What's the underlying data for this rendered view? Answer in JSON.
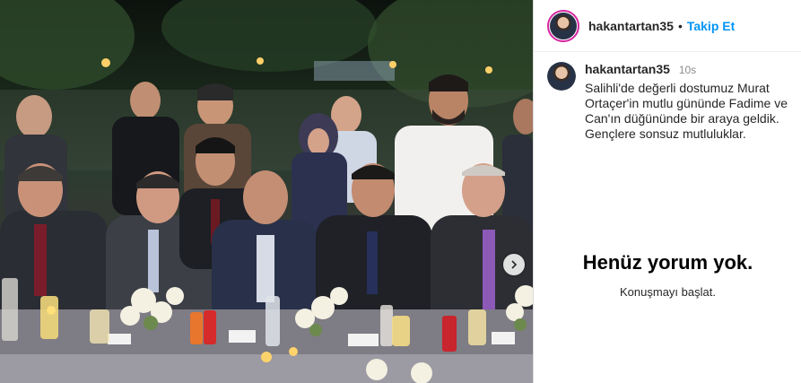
{
  "header": {
    "username": "hakantartan35",
    "separator": "•",
    "follow_label": "Takip Et"
  },
  "post": {
    "username": "hakantartan35",
    "time": "10s",
    "caption": "Salihli'de değerli dostumuz Murat Ortaçer'in mutlu gününde Fadime ve Can'ın düğününde bir araya geldik.\nGençlere sonsuz mutluluklar."
  },
  "comments": {
    "empty_title": "Henüz yorum yok.",
    "empty_subtitle": "Konuşmayı başlat."
  },
  "media": {
    "next_icon": "chevron-right-icon"
  },
  "colors": {
    "follow_blue": "#0095f6",
    "text": "#262626",
    "muted": "#8e8e8e"
  }
}
